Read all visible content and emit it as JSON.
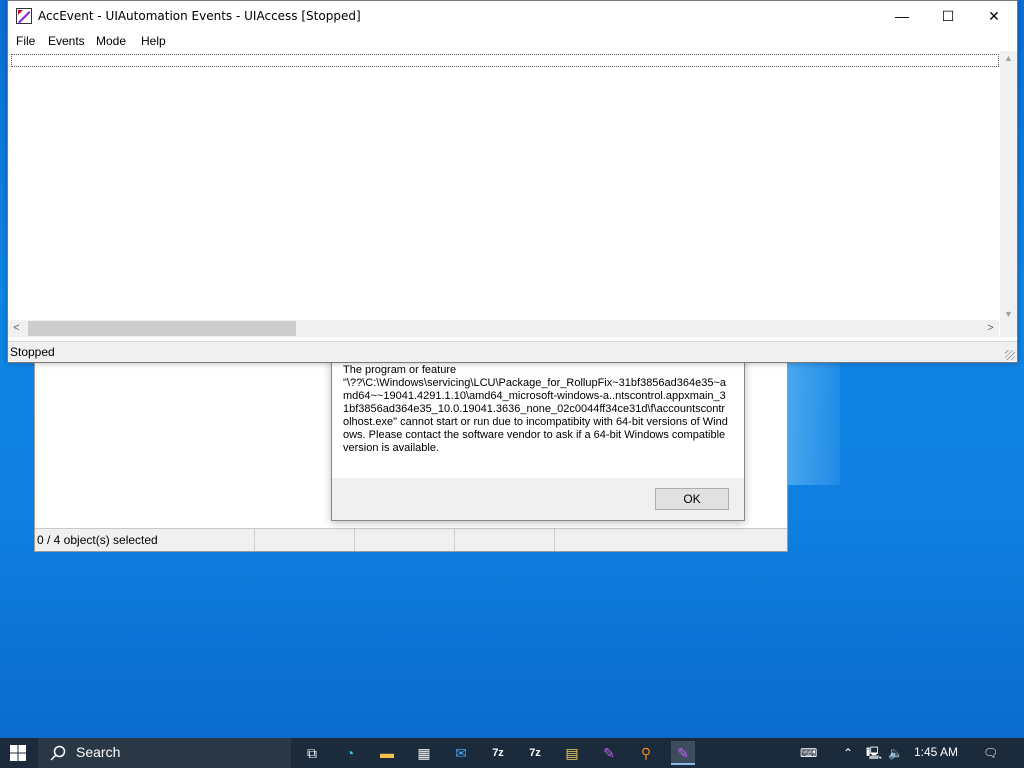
{
  "main_window": {
    "title": "AccEvent - UIAutomation Events - UIAccess [Stopped]",
    "menu": [
      "File",
      "Events",
      "Mode",
      "Help"
    ],
    "status": "Stopped",
    "controls": {
      "minimize": "—",
      "maximize": "☐",
      "close": "✕"
    }
  },
  "background_window": {
    "status_cells": [
      "0 / 4 object(s) selected",
      "",
      "",
      ""
    ]
  },
  "dialog": {
    "message": "The program or feature\n\"\\??\\C:\\Windows\\servicing\\LCU\\Package_for_RollupFix~31bf3856ad364e35~amd64~~19041.4291.1.10\\amd64_microsoft-windows-a..ntscontrol.appxmain_31bf3856ad364e35_10.0.19041.3636_none_02c0044ff34ce31d\\f\\accountscontrolhost.exe\" cannot start or run due to incompatibity with 64-bit versions of Windows. Please contact the software vendor to ask if a 64-bit Windows compatible version is available.",
    "ok_label": "OK"
  },
  "taskbar": {
    "search_label": "Search",
    "apps": [
      "task-view",
      "edge",
      "file-explorer",
      "store",
      "mail",
      "7zip-a",
      "7zip-b",
      "control-panel",
      "accevent-a",
      "search-tool",
      "accevent-b"
    ],
    "app_glyphs": [
      "⧉",
      "◔",
      "▬",
      "▦",
      "✉",
      "7z",
      "7z",
      "▤",
      "✎",
      "⚲",
      "✎"
    ],
    "clock": "1:45 AM"
  },
  "colors": {
    "desktop": "#0f7fe0",
    "taskbar": "#1b2b3c"
  }
}
